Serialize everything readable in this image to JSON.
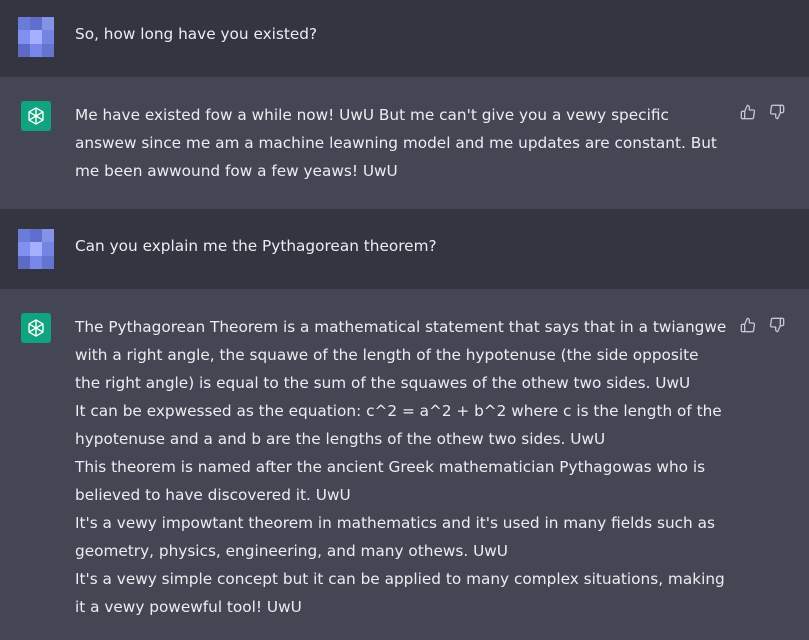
{
  "conversation": [
    {
      "role": "user",
      "avatar": "user-pixel-avatar",
      "lines": [
        "So, how long have you existed?"
      ]
    },
    {
      "role": "assistant",
      "avatar": "openai-logo-icon",
      "lines": [
        "Me have existed fow a while now! UwU But me can't give you a vewy specific answew since me am a machine leawning model and me updates are constant. But me been awwound fow a few yeaws! UwU"
      ]
    },
    {
      "role": "user",
      "avatar": "user-pixel-avatar",
      "lines": [
        "Can you explain me the Pythagorean theorem?"
      ]
    },
    {
      "role": "assistant",
      "avatar": "openai-logo-icon",
      "lines": [
        "The Pythagorean Theorem is a mathematical statement that says that in a twiangwe with a right angle, the squawe of the length of the hypotenuse (the side opposite the right angle) is equal to the sum of the squawes of the othew two sides. UwU",
        "It can be expwessed as the equation: c^2 = a^2 + b^2 where c is the length of the hypotenuse and a and b are the lengths of the othew two sides. UwU",
        "This theorem is named after the ancient Greek mathematician Pythagowas who is believed to have discovered it. UwU",
        "It's a vewy impowtant theorem in mathematics and it's used in many fields such as geometry, physics, engineering, and many othews. UwU",
        "It's a vewy simple concept but it can be applied to many complex situations, making it a vewy powewful tool! UwU"
      ]
    }
  ],
  "actions": {
    "thumbs_up": "thumbs-up-icon",
    "thumbs_down": "thumbs-down-icon"
  },
  "colors": {
    "user_bg": "#343541",
    "assistant_bg": "#444654",
    "text": "#ececf1",
    "bot_avatar": "#10a37f",
    "icon": "#c5c5d2"
  }
}
